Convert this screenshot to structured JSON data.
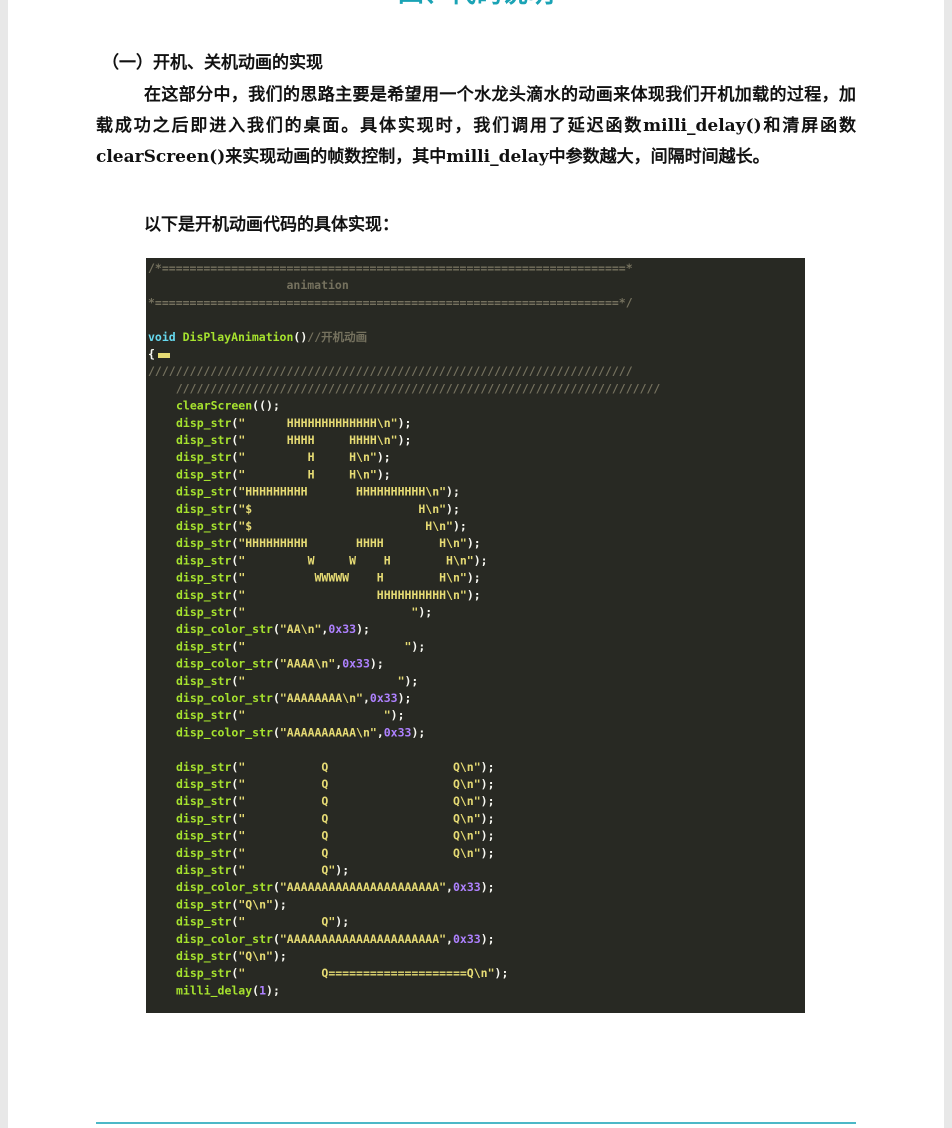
{
  "section_title": "四、代码说明",
  "subheading": "（一）开机、关机动画的实现",
  "paragraph1": "在这部分中，我们的思路主要是希望用一个水龙头滴水的动画来体现我们开机加载的过程，加载成功之后即进入我们的桌面。具体实现时，我们调用了延迟函数milli_delay()和清屏函数clearScreen()来实现动画的帧数控制，其中milli_delay中参数越大，间隔时间越长。",
  "paragraph2": "以下是开机动画代码的具体实现：",
  "colors": {
    "code_bg": "#282923",
    "keyword": "#66d9ef",
    "function": "#a6e22e",
    "string": "#e6db74",
    "number": "#ae81ff",
    "comment": "#75715e",
    "plain": "#f8f8f2",
    "title_accent": "#1aa3b5"
  },
  "code": {
    "header_lines": [
      "/*===================================================================*",
      "                    animation",
      "*===================================================================*/"
    ],
    "func_keyword": "void",
    "func_name": "DisPlayAnimation",
    "func_parens": "()",
    "func_comment": "//开机动画",
    "open_brace": "{",
    "slash_line_1": "//////////////////////////////////////////////////////////////////////",
    "slash_line_2": "    //////////////////////////////////////////////////////////////////////",
    "body": [
      {
        "fn": "clearScreen",
        "arg": "",
        "tail": "();"
      },
      {
        "fn": "disp_str",
        "arg": "\"      HHHHHHHHHHHHH\\n\"",
        "tail": ");"
      },
      {
        "fn": "disp_str",
        "arg": "\"      HHHH     HHHH\\n\"",
        "tail": ");"
      },
      {
        "fn": "disp_str",
        "arg": "\"         H     H\\n\"",
        "tail": ");"
      },
      {
        "fn": "disp_str",
        "arg": "\"         H     H\\n\"",
        "tail": ");"
      },
      {
        "fn": "disp_str",
        "arg": "\"HHHHHHHHH       HHHHHHHHHH\\n\"",
        "tail": ");"
      },
      {
        "fn": "disp_str",
        "arg": "\"$                        H\\n\"",
        "tail": ");"
      },
      {
        "fn": "disp_str",
        "arg": "\"$                         H\\n\"",
        "tail": ");"
      },
      {
        "fn": "disp_str",
        "arg": "\"HHHHHHHHH       HHHH        H\\n\"",
        "tail": ");"
      },
      {
        "fn": "disp_str",
        "arg": "\"         W     W    H        H\\n\"",
        "tail": ");"
      },
      {
        "fn": "disp_str",
        "arg": "\"          WWWWW    H        H\\n\"",
        "tail": ");"
      },
      {
        "fn": "disp_str",
        "arg": "\"                   HHHHHHHHHH\\n\"",
        "tail": ");"
      },
      {
        "fn": "disp_str",
        "arg": "\"                        \"",
        "tail": ");"
      },
      {
        "fn": "disp_color_str",
        "arg": "\"AA\\n\"",
        "num": "0x33",
        "tail": ");"
      },
      {
        "fn": "disp_str",
        "arg": "\"                       \"",
        "tail": ");"
      },
      {
        "fn": "disp_color_str",
        "arg": "\"AAAA\\n\"",
        "num": "0x33",
        "tail": ");"
      },
      {
        "fn": "disp_str",
        "arg": "\"                      \"",
        "tail": ");"
      },
      {
        "fn": "disp_color_str",
        "arg": "\"AAAAAAAA\\n\"",
        "num": "0x33",
        "tail": ");"
      },
      {
        "fn": "disp_str",
        "arg": "\"                    \"",
        "tail": ");"
      },
      {
        "fn": "disp_color_str",
        "arg": "\"AAAAAAAAAA\\n\"",
        "num": "0x33",
        "tail": ");"
      },
      {
        "blank": true
      },
      {
        "fn": "disp_str",
        "arg": "\"           Q                  Q\\n\"",
        "tail": ");"
      },
      {
        "fn": "disp_str",
        "arg": "\"           Q                  Q\\n\"",
        "tail": ");"
      },
      {
        "fn": "disp_str",
        "arg": "\"           Q                  Q\\n\"",
        "tail": ");"
      },
      {
        "fn": "disp_str",
        "arg": "\"           Q                  Q\\n\"",
        "tail": ");"
      },
      {
        "fn": "disp_str",
        "arg": "\"           Q                  Q\\n\"",
        "tail": ");"
      },
      {
        "fn": "disp_str",
        "arg": "\"           Q                  Q\\n\"",
        "tail": ");"
      },
      {
        "fn": "disp_str",
        "arg": "\"           Q\"",
        "tail": ");"
      },
      {
        "fn": "disp_color_str",
        "arg": "\"AAAAAAAAAAAAAAAAAAAAAA\"",
        "num": "0x33",
        "tail": ");"
      },
      {
        "fn": "disp_str",
        "arg": "\"Q\\n\"",
        "tail": ");"
      },
      {
        "fn": "disp_str",
        "arg": "\"           Q\"",
        "tail": ");"
      },
      {
        "fn": "disp_color_str",
        "arg": "\"AAAAAAAAAAAAAAAAAAAAAA\"",
        "num": "0x33",
        "tail": ");"
      },
      {
        "fn": "disp_str",
        "arg": "\"Q\\n\"",
        "tail": ");"
      },
      {
        "fn": "disp_str",
        "arg": "\"           Q====================Q\\n\"",
        "tail": ");"
      },
      {
        "fn": "milli_delay",
        "arg": "",
        "num": "1",
        "tail": ");"
      }
    ]
  }
}
